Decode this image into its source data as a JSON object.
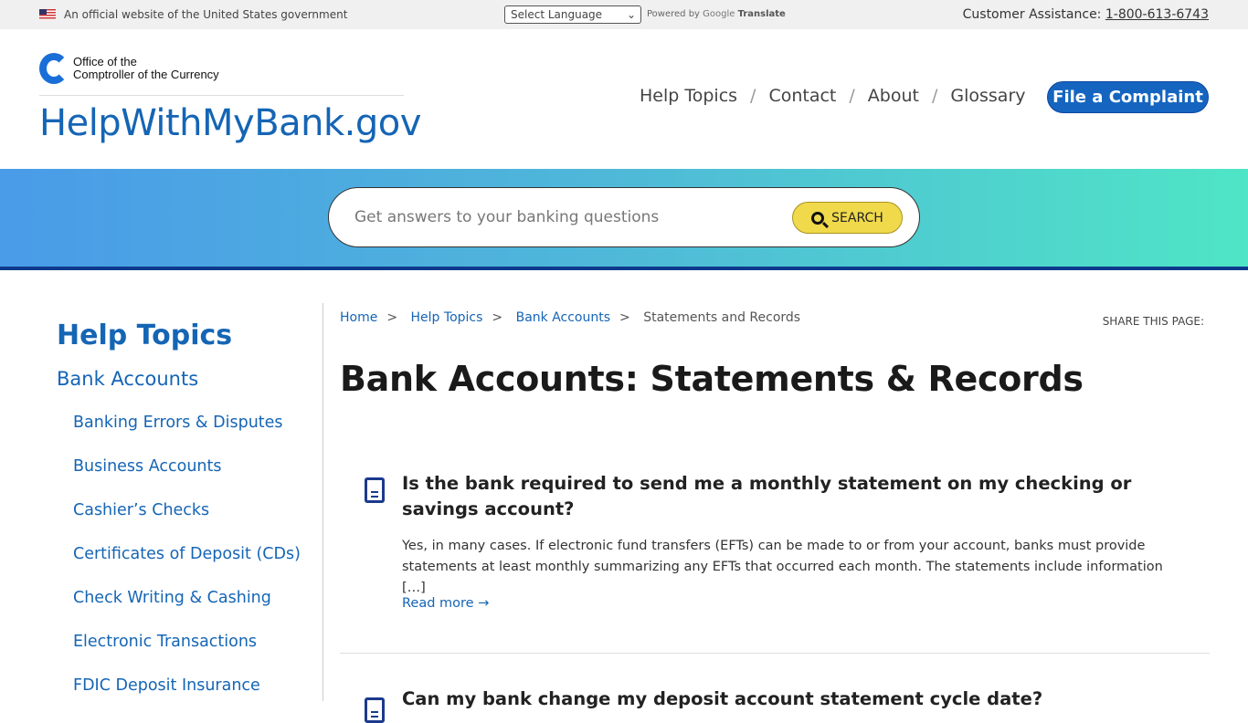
{
  "topbar": {
    "official": "An official website of the United States government",
    "language": "Select Language",
    "powered_by": "Powered by",
    "google": "Google",
    "translate": "Translate",
    "assistance_label": "Customer Assistance:",
    "phone": "1-800-613-6743"
  },
  "header": {
    "logo_line1": "Office of the",
    "logo_line2": "Comptroller of the Currency",
    "site_name": "HelpWithMyBank.gov",
    "nav": [
      "Help Topics",
      "Contact",
      "About",
      "Glossary"
    ],
    "complaint": "File a Complaint",
    "brand_color": "#1565b5"
  },
  "search": {
    "placeholder": "Get answers to your banking questions",
    "button": "SEARCH"
  },
  "sidebar": {
    "title": "Help Topics",
    "section": "Bank Accounts",
    "items": [
      "Banking Errors & Disputes",
      "Business Accounts",
      "Cashier’s Checks",
      "Certificates of Deposit (CDs)",
      "Check Writing & Cashing",
      "Electronic Transactions",
      "FDIC Deposit Insurance"
    ]
  },
  "breadcrumb": {
    "items": [
      "Home",
      "Help Topics",
      "Bank Accounts"
    ],
    "current": "Statements and Records",
    "sep": ">"
  },
  "share": "SHARE THIS PAGE:",
  "page_title": "Bank Accounts: Statements & Records",
  "articles": [
    {
      "question": "Is the bank required to send me a monthly statement on my checking or savings account?",
      "answer": "Yes, in many cases. If electronic fund transfers (EFTs) can be made to or from your account, banks must provide statements at least monthly summarizing any EFTs that occurred each month. The statements include information […]",
      "read_more": "Read more →"
    },
    {
      "question": "Can my bank change my deposit account statement cycle date?"
    }
  ]
}
